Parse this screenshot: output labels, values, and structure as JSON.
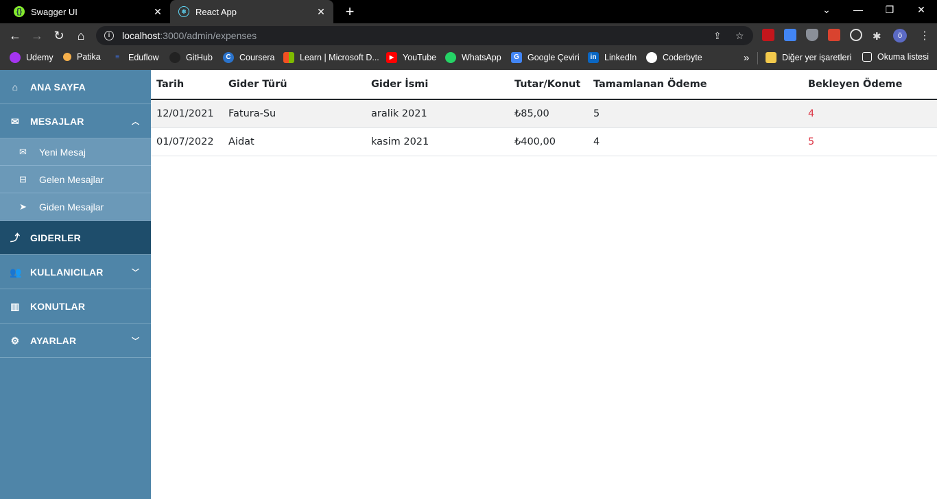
{
  "browser": {
    "tabs": [
      {
        "title": "Swagger UI",
        "close": "✕"
      },
      {
        "title": "React App",
        "close": "✕"
      }
    ],
    "new_tab": "+",
    "window_buttons": [
      "⌄",
      "—",
      "❐",
      "✕"
    ],
    "url_host": "localhost",
    "url_rest": ":3000/admin/expenses",
    "profile_initial": "ö",
    "bookmarks": [
      {
        "label": "Udemy",
        "icon": "udemy-icon",
        "color": "#a435f0"
      },
      {
        "label": "Patika",
        "icon": "patika-icon",
        "color": "#f6b04b"
      },
      {
        "label": "Eduflow",
        "icon": "eduflow-icon",
        "color": "#3d6fe0"
      },
      {
        "label": "GitHub",
        "icon": "github-icon",
        "color": "#222222"
      },
      {
        "label": "Coursera",
        "icon": "coursera-icon",
        "color": "#2a73cc"
      },
      {
        "label": "Learn | Microsoft D...",
        "icon": "microsoft-icon",
        "color": "#f25022"
      },
      {
        "label": "YouTube",
        "icon": "youtube-icon",
        "color": "#ff0000"
      },
      {
        "label": "WhatsApp",
        "icon": "whatsapp-icon",
        "color": "#25d366"
      },
      {
        "label": "Google Çeviri",
        "icon": "google-translate-icon",
        "color": "#4285f4"
      },
      {
        "label": "LinkedIn",
        "icon": "linkedin-icon",
        "color": "#0a66c2"
      },
      {
        "label": "Coderbyte",
        "icon": "coderbyte-icon",
        "color": "#ffffff"
      }
    ],
    "bookmarks_overflow": "»",
    "other_bookmarks": "Diğer yer işaretleri",
    "reading_list": "Okuma listesi"
  },
  "sidebar": {
    "items": [
      {
        "label": "ANA SAYFA",
        "icon": "home-icon"
      },
      {
        "label": "MESAJLAR",
        "icon": "mail-icon",
        "chevron": "up"
      },
      {
        "label": "Yeni Mesaj",
        "icon": "compose-icon"
      },
      {
        "label": "Gelen Mesajlar",
        "icon": "inbox-icon"
      },
      {
        "label": "Giden Mesajlar",
        "icon": "send-icon"
      },
      {
        "label": "GIDERLER",
        "icon": "expense-icon",
        "active": true
      },
      {
        "label": "KULLANICILAR",
        "icon": "users-icon",
        "chevron": "down"
      },
      {
        "label": "KONUTLAR",
        "icon": "buildings-icon"
      },
      {
        "label": "AYARLAR",
        "icon": "gear-icon",
        "chevron": "down"
      }
    ]
  },
  "table": {
    "headers": [
      "Tarih",
      "Gider Türü",
      "Gider İsmi",
      "Tutar/Konut",
      "Tamamlanan Ödeme",
      "Bekleyen Ödeme"
    ],
    "rows": [
      [
        "12/01/2021",
        "Fatura-Su",
        "aralik 2021",
        "₺85,00",
        "5",
        "4"
      ],
      [
        "01/07/2022",
        "Aidat",
        "kasim 2021",
        "₺400,00",
        "4",
        "5"
      ]
    ],
    "pending_color": "#dc3545"
  },
  "colors": {
    "sidebar_bg": "#4f85a8",
    "sidebar_active": "#1e4d6b",
    "sidebar_sub": "#6b99b8"
  }
}
